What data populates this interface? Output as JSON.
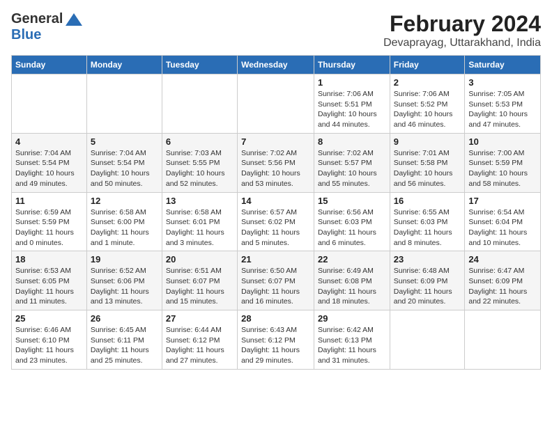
{
  "logo": {
    "general": "General",
    "blue": "Blue"
  },
  "title": "February 2024",
  "subtitle": "Devaprayag, Uttarakhand, India",
  "headers": [
    "Sunday",
    "Monday",
    "Tuesday",
    "Wednesday",
    "Thursday",
    "Friday",
    "Saturday"
  ],
  "weeks": [
    [
      {
        "day": "",
        "info": ""
      },
      {
        "day": "",
        "info": ""
      },
      {
        "day": "",
        "info": ""
      },
      {
        "day": "",
        "info": ""
      },
      {
        "day": "1",
        "info": "Sunrise: 7:06 AM\nSunset: 5:51 PM\nDaylight: 10 hours\nand 44 minutes."
      },
      {
        "day": "2",
        "info": "Sunrise: 7:06 AM\nSunset: 5:52 PM\nDaylight: 10 hours\nand 46 minutes."
      },
      {
        "day": "3",
        "info": "Sunrise: 7:05 AM\nSunset: 5:53 PM\nDaylight: 10 hours\nand 47 minutes."
      }
    ],
    [
      {
        "day": "4",
        "info": "Sunrise: 7:04 AM\nSunset: 5:54 PM\nDaylight: 10 hours\nand 49 minutes."
      },
      {
        "day": "5",
        "info": "Sunrise: 7:04 AM\nSunset: 5:54 PM\nDaylight: 10 hours\nand 50 minutes."
      },
      {
        "day": "6",
        "info": "Sunrise: 7:03 AM\nSunset: 5:55 PM\nDaylight: 10 hours\nand 52 minutes."
      },
      {
        "day": "7",
        "info": "Sunrise: 7:02 AM\nSunset: 5:56 PM\nDaylight: 10 hours\nand 53 minutes."
      },
      {
        "day": "8",
        "info": "Sunrise: 7:02 AM\nSunset: 5:57 PM\nDaylight: 10 hours\nand 55 minutes."
      },
      {
        "day": "9",
        "info": "Sunrise: 7:01 AM\nSunset: 5:58 PM\nDaylight: 10 hours\nand 56 minutes."
      },
      {
        "day": "10",
        "info": "Sunrise: 7:00 AM\nSunset: 5:59 PM\nDaylight: 10 hours\nand 58 minutes."
      }
    ],
    [
      {
        "day": "11",
        "info": "Sunrise: 6:59 AM\nSunset: 5:59 PM\nDaylight: 11 hours\nand 0 minutes."
      },
      {
        "day": "12",
        "info": "Sunrise: 6:58 AM\nSunset: 6:00 PM\nDaylight: 11 hours\nand 1 minute."
      },
      {
        "day": "13",
        "info": "Sunrise: 6:58 AM\nSunset: 6:01 PM\nDaylight: 11 hours\nand 3 minutes."
      },
      {
        "day": "14",
        "info": "Sunrise: 6:57 AM\nSunset: 6:02 PM\nDaylight: 11 hours\nand 5 minutes."
      },
      {
        "day": "15",
        "info": "Sunrise: 6:56 AM\nSunset: 6:03 PM\nDaylight: 11 hours\nand 6 minutes."
      },
      {
        "day": "16",
        "info": "Sunrise: 6:55 AM\nSunset: 6:03 PM\nDaylight: 11 hours\nand 8 minutes."
      },
      {
        "day": "17",
        "info": "Sunrise: 6:54 AM\nSunset: 6:04 PM\nDaylight: 11 hours\nand 10 minutes."
      }
    ],
    [
      {
        "day": "18",
        "info": "Sunrise: 6:53 AM\nSunset: 6:05 PM\nDaylight: 11 hours\nand 11 minutes."
      },
      {
        "day": "19",
        "info": "Sunrise: 6:52 AM\nSunset: 6:06 PM\nDaylight: 11 hours\nand 13 minutes."
      },
      {
        "day": "20",
        "info": "Sunrise: 6:51 AM\nSunset: 6:07 PM\nDaylight: 11 hours\nand 15 minutes."
      },
      {
        "day": "21",
        "info": "Sunrise: 6:50 AM\nSunset: 6:07 PM\nDaylight: 11 hours\nand 16 minutes."
      },
      {
        "day": "22",
        "info": "Sunrise: 6:49 AM\nSunset: 6:08 PM\nDaylight: 11 hours\nand 18 minutes."
      },
      {
        "day": "23",
        "info": "Sunrise: 6:48 AM\nSunset: 6:09 PM\nDaylight: 11 hours\nand 20 minutes."
      },
      {
        "day": "24",
        "info": "Sunrise: 6:47 AM\nSunset: 6:09 PM\nDaylight: 11 hours\nand 22 minutes."
      }
    ],
    [
      {
        "day": "25",
        "info": "Sunrise: 6:46 AM\nSunset: 6:10 PM\nDaylight: 11 hours\nand 23 minutes."
      },
      {
        "day": "26",
        "info": "Sunrise: 6:45 AM\nSunset: 6:11 PM\nDaylight: 11 hours\nand 25 minutes."
      },
      {
        "day": "27",
        "info": "Sunrise: 6:44 AM\nSunset: 6:12 PM\nDaylight: 11 hours\nand 27 minutes."
      },
      {
        "day": "28",
        "info": "Sunrise: 6:43 AM\nSunset: 6:12 PM\nDaylight: 11 hours\nand 29 minutes."
      },
      {
        "day": "29",
        "info": "Sunrise: 6:42 AM\nSunset: 6:13 PM\nDaylight: 11 hours\nand 31 minutes."
      },
      {
        "day": "",
        "info": ""
      },
      {
        "day": "",
        "info": ""
      }
    ]
  ]
}
